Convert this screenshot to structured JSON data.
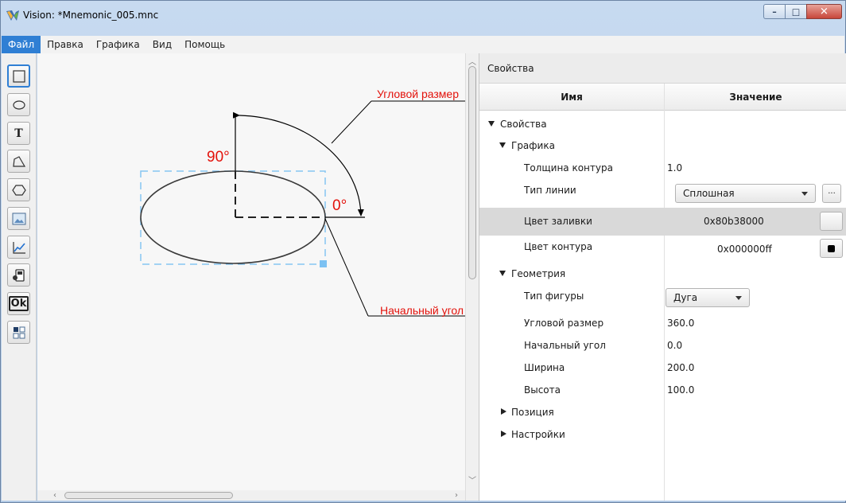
{
  "window": {
    "title": "Vision: *Mnemonic_005.mnc",
    "buttons": {
      "minimize": "–",
      "maximize": "□",
      "close": "✕"
    }
  },
  "menu": {
    "items": [
      {
        "label": "Файл",
        "active": true
      },
      {
        "label": "Правка",
        "active": false
      },
      {
        "label": "Графика",
        "active": false
      },
      {
        "label": "Вид",
        "active": false
      },
      {
        "label": "Помощь",
        "active": false
      }
    ]
  },
  "toolbar": {
    "tools": [
      {
        "name": "rectangle-tool",
        "icon": "rectangle-icon",
        "selected": true
      },
      {
        "name": "ellipse-tool",
        "icon": "ellipse-icon",
        "selected": false
      },
      {
        "name": "text-tool",
        "icon": "text-icon",
        "label": "T",
        "selected": false
      },
      {
        "name": "polyline-tool",
        "icon": "polyline-icon",
        "selected": false
      },
      {
        "name": "polygon-tool",
        "icon": "hexagon-icon",
        "selected": false
      },
      {
        "name": "image-tool",
        "icon": "image-icon",
        "selected": false
      },
      {
        "name": "chart-tool",
        "icon": "chart-icon",
        "selected": false
      },
      {
        "name": "device-tool",
        "icon": "device-icon",
        "selected": false
      },
      {
        "name": "button-tool",
        "icon": "ok-icon",
        "label": "Ok",
        "selected": false
      },
      {
        "name": "widget-tool",
        "icon": "grid-icon",
        "selected": false
      }
    ]
  },
  "canvas": {
    "annotations": {
      "angular_size": "Угловой размер",
      "start_angle": "Начальный угол",
      "deg90": "90°",
      "deg0": "0°"
    },
    "accent_color": "#e3120b",
    "selection_color": "#86c5f2"
  },
  "properties": {
    "panel_title": "Свойства",
    "col_name": "Имя",
    "col_value": "Значение",
    "root": "Свойства",
    "graphics_group": "Графика",
    "stroke_width": {
      "label": "Толщина контура",
      "value": "1.0"
    },
    "line_type": {
      "label": "Тип линии",
      "value": "Сплошная",
      "more": "..."
    },
    "fill_color": {
      "label": "Цвет заливки",
      "value": "0x80b38000"
    },
    "stroke_color": {
      "label": "Цвет контура",
      "value": "0x000000ff",
      "swatch": "#000000"
    },
    "geometry_group": "Геометрия",
    "shape_type": {
      "label": "Тип фигуры",
      "value": "Дуга"
    },
    "angular_size": {
      "label": "Угловой размер",
      "value": "360.0"
    },
    "start_angle": {
      "label": "Начальный угол",
      "value": "0.0"
    },
    "width": {
      "label": "Ширина",
      "value": "200.0"
    },
    "height": {
      "label": "Высота",
      "value": "100.0"
    },
    "position_group": "Позиция",
    "settings_group": "Настройки"
  }
}
